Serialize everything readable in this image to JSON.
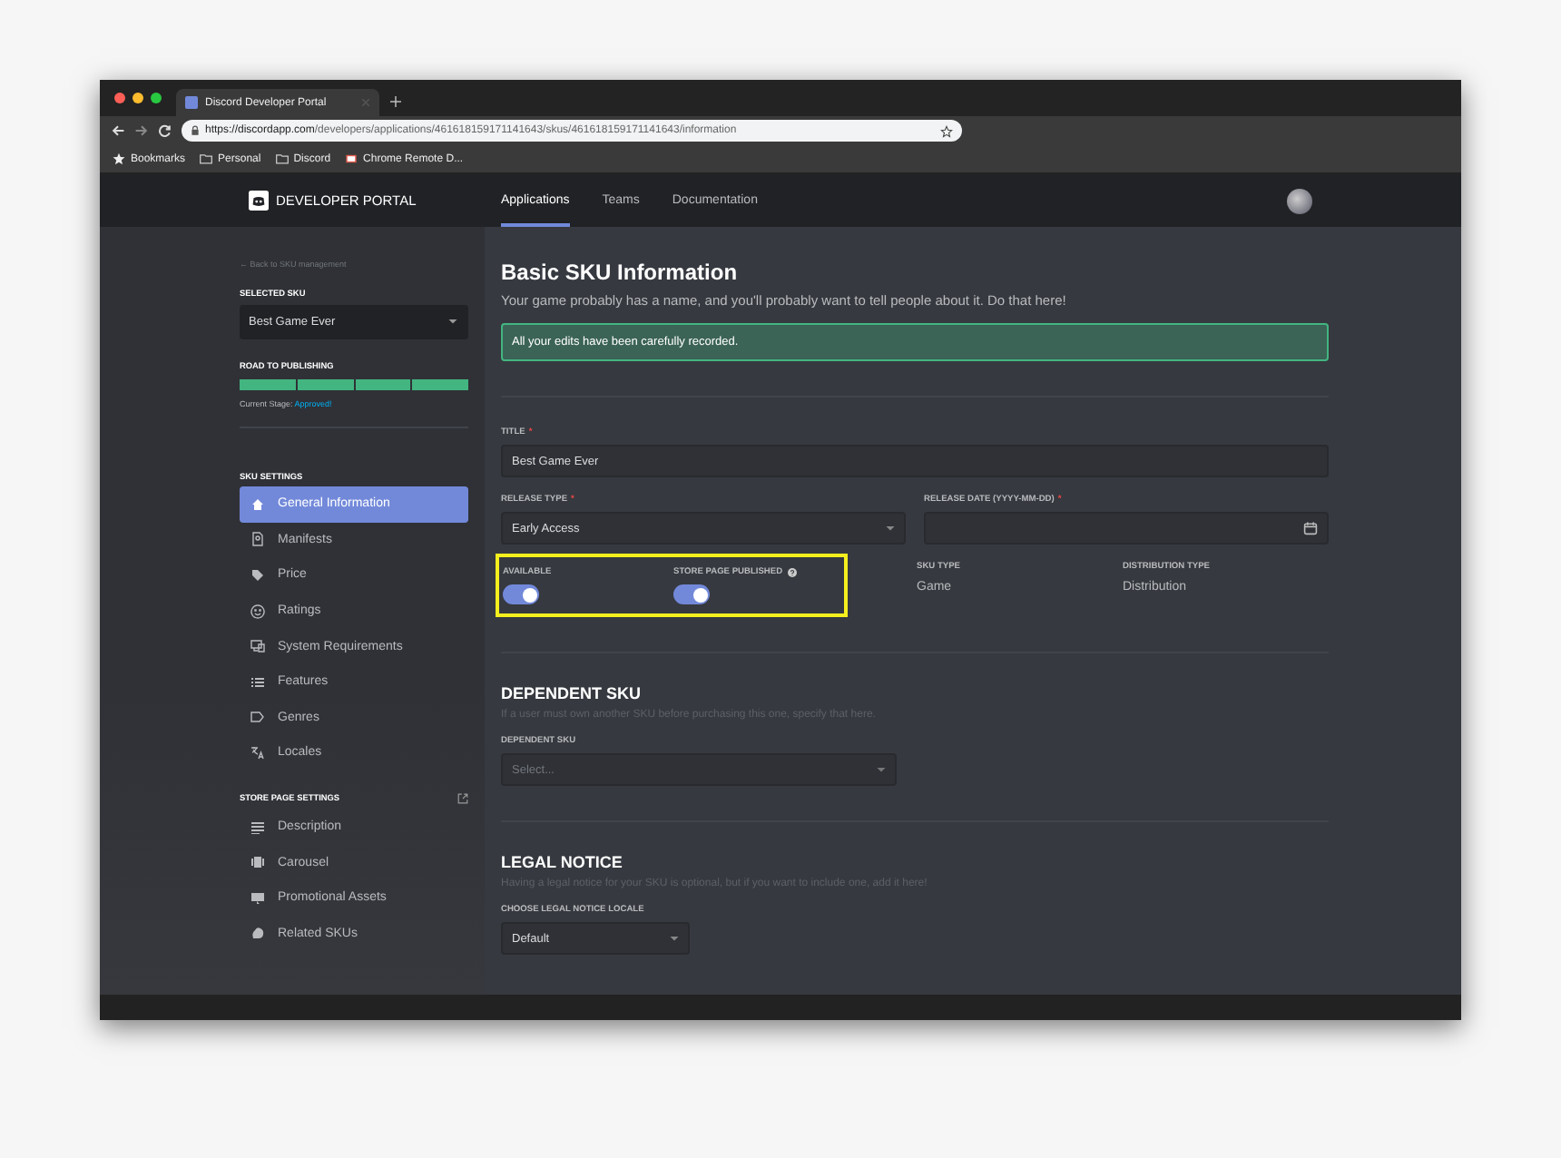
{
  "browser": {
    "tab_title": "Discord Developer Portal",
    "url_host": "https://discordapp.com",
    "url_path": "/developers/applications/461618159171141643/skus/461618159171141643/information",
    "bookmarks": [
      {
        "label": "Bookmarks",
        "kind": "star"
      },
      {
        "label": "Personal",
        "kind": "folder"
      },
      {
        "label": "Discord",
        "kind": "folder"
      },
      {
        "label": "Chrome Remote D...",
        "kind": "app"
      }
    ]
  },
  "header": {
    "brand": "DEVELOPER PORTAL",
    "nav": [
      {
        "label": "Applications",
        "selected": true
      },
      {
        "label": "Teams",
        "selected": false
      },
      {
        "label": "Documentation",
        "selected": false
      }
    ]
  },
  "sidebar": {
    "back_link": "← Back to SKU management",
    "selected_sku_label": "SELECTED SKU",
    "selected_sku_value": "Best Game Ever",
    "road_label": "ROAD TO PUBLISHING",
    "progress": {
      "level": 1
    },
    "stage_label": "Current Stage:",
    "stage_value": "Approved!",
    "sections": [
      {
        "title": "SKU SETTINGS",
        "external": false,
        "items": [
          {
            "label": "General Information",
            "selected": true
          },
          {
            "label": "Manifests",
            "selected": false
          },
          {
            "label": "Price",
            "selected": false
          },
          {
            "label": "Ratings",
            "selected": false
          },
          {
            "label": "System Requirements",
            "selected": false
          },
          {
            "label": "Features",
            "selected": false
          },
          {
            "label": "Genres",
            "selected": false
          },
          {
            "label": "Locales",
            "selected": false
          }
        ]
      },
      {
        "title": "STORE PAGE SETTINGS",
        "external": true,
        "items": [
          {
            "label": "Description",
            "selected": false
          },
          {
            "label": "Carousel",
            "selected": false
          },
          {
            "label": "Promotional Assets",
            "selected": false
          },
          {
            "label": "Related SKUs",
            "selected": false
          }
        ]
      }
    ]
  },
  "main": {
    "title": "Basic SKU Information",
    "subtitle": "Your game probably has a name, and you'll probably want to tell people about it. Do that here!",
    "notice": "All your edits have been carefully recorded.",
    "title_field": {
      "label": "TITLE",
      "required_mark": "*",
      "value": "Best Game Ever"
    },
    "release_type": {
      "label": "RELEASE TYPE",
      "required_mark": "*",
      "value": "Early Access"
    },
    "release_date": {
      "label": "RELEASE DATE (YYYY-MM-DD)",
      "required_mark": "*"
    },
    "toggles": [
      {
        "label": "AVAILABLE",
        "on": true,
        "help": false
      },
      {
        "label": "STORE PAGE PUBLISHED",
        "on": true,
        "help": true
      }
    ],
    "info": [
      {
        "label": "SKU TYPE",
        "value": "Game"
      },
      {
        "label": "DISTRIBUTION TYPE",
        "value": "Distribution"
      }
    ],
    "dependent": {
      "title": "DEPENDENT SKU",
      "description": "If a user must own another SKU before purchasing this one, specify that here.",
      "label": "DEPENDENT SKU",
      "placeholder": "Select..."
    },
    "legal": {
      "title": "LEGAL NOTICE",
      "description": "Having a legal notice for your SKU is optional, but if you want to include one, add it here!",
      "label": "CHOOSE LEGAL NOTICE LOCALE",
      "value": "Default"
    }
  }
}
